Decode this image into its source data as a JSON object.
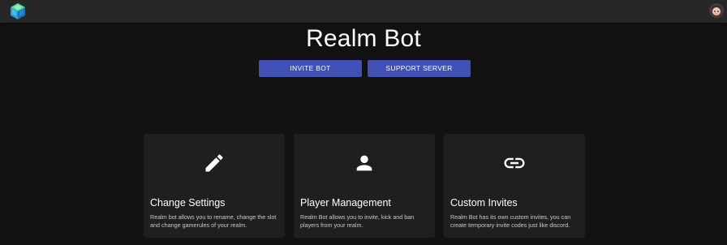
{
  "header": {
    "logo_icon": "realm-cube-icon",
    "avatar_icon": "user-avatar-icon"
  },
  "hero": {
    "title": "Realm Bot",
    "buttons": {
      "invite_label": "INVITE BOT",
      "support_label": "SUPPORT SERVER"
    }
  },
  "features": [
    {
      "icon": "pencil-icon",
      "title": "Change Settings",
      "description": "Realm bot allows you to rename, change the slot and change gamerules of your realm."
    },
    {
      "icon": "person-icon",
      "title": "Player Management",
      "description": "Realm Bot allows you to invite, kick and ban players from your realm."
    },
    {
      "icon": "link-icon",
      "title": "Custom Invites",
      "description": "Realm Bot has its own custom invites, you can create temporary invite codes just like discord."
    }
  ],
  "colors": {
    "background": "#121212",
    "topbar": "#272727",
    "card": "#1f1f1f",
    "accent": "#3f51b5"
  }
}
